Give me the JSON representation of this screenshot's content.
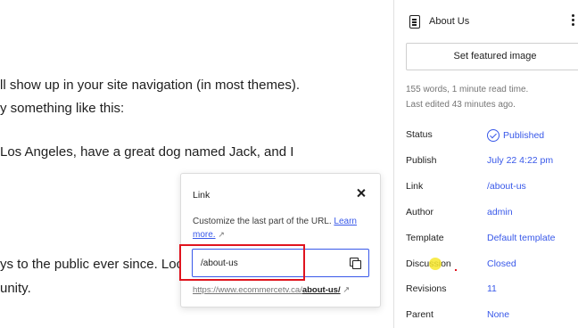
{
  "editor": {
    "lines": [
      "ll show up in your site navigation (in most themes).",
      "y something like this:",
      "Los Angeles, have a great dog named Jack, and I",
      "ys to the public ever since. Loca",
      "unity."
    ]
  },
  "sidebar": {
    "title": "About Us",
    "featured_image_label": "Set featured image",
    "meta_words": "155 words, 1 minute read time.",
    "meta_edited": "Last edited 43 minutes ago.",
    "rows": [
      {
        "label": "Status",
        "value": "Published"
      },
      {
        "label": "Publish",
        "value": "July 22 4:22 pm"
      },
      {
        "label": "Link",
        "value": "/about-us"
      },
      {
        "label": "Author",
        "value": "admin"
      },
      {
        "label": "Template",
        "value": "Default template"
      },
      {
        "label": "Discussion",
        "value": "Closed"
      },
      {
        "label": "Revisions",
        "value": "11"
      },
      {
        "label": "Parent",
        "value": "None"
      }
    ],
    "icons": {
      "page": "page-icon",
      "more": "more-vertical-icon",
      "status": "check-circle-icon"
    },
    "accent_color": "#3858e9"
  },
  "link_popover": {
    "title": "Link",
    "help_text": "Customize the last part of the URL. ",
    "learn_more": "Learn more.",
    "slug_value": "/about-us",
    "url_prefix": "https://www.ecommercetv.ca/",
    "url_slug": "about-us/",
    "icons": {
      "close": "close-icon",
      "copy": "copy-icon",
      "external": "external-link-icon"
    }
  },
  "annotation": {
    "highlight_color": "#e0141e",
    "cursor_color": "#f7e82e"
  }
}
